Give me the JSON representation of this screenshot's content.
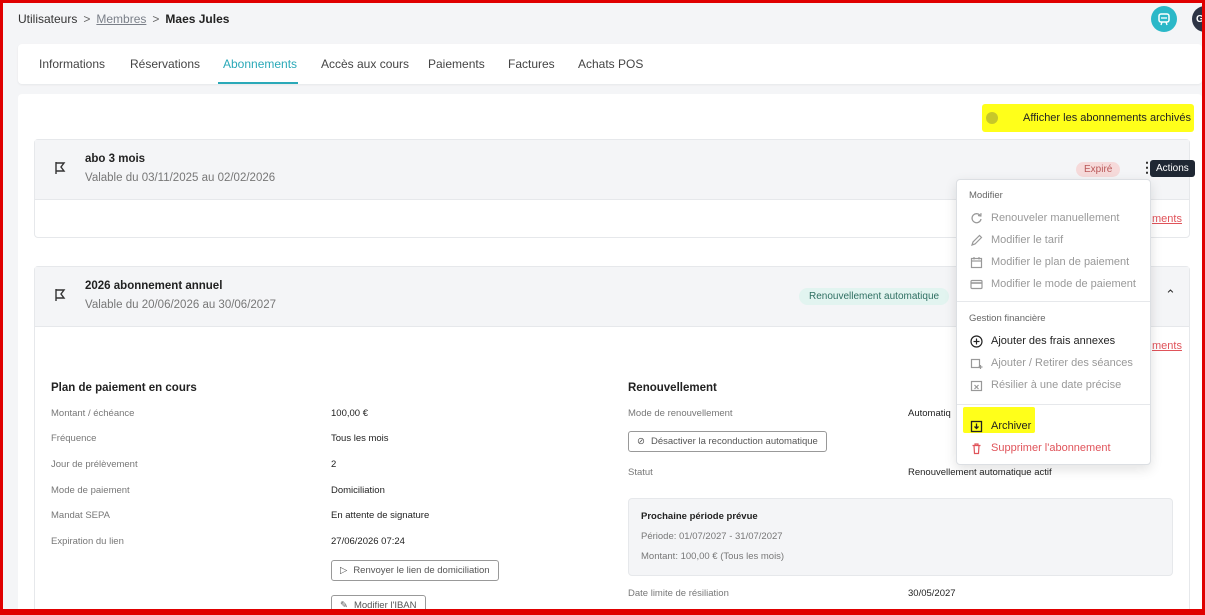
{
  "breadcrumb": {
    "root": "Utilisateurs",
    "sep": ">",
    "members": "Membres",
    "current": "Maes Jules"
  },
  "avatar_initial": "G",
  "tabs": [
    "Informations",
    "Réservations",
    "Abonnements",
    "Accès aux cours",
    "Paiements",
    "Factures",
    "Achats POS"
  ],
  "active_tab": "Abonnements",
  "archived_toggle_label": "Afficher les abonnements archivés",
  "card1": {
    "title": "abo 3 mois",
    "validity": "Valable du 03/11/2025 au 02/02/2026",
    "status": "Expiré",
    "link": "ments"
  },
  "tooltip": "Actions",
  "card2": {
    "title": "2026 abonnement annuel",
    "validity": "Valable du 20/06/2026 au 30/06/2027",
    "status": "Renouvellement automatique",
    "link": "ments",
    "plan": {
      "heading": "Plan de paiement en cours",
      "rows": [
        {
          "label": "Montant / échéance",
          "value": "100,00 €"
        },
        {
          "label": "Fréquence",
          "value": "Tous les mois"
        },
        {
          "label": "Jour de prélèvement",
          "value": "2"
        },
        {
          "label": "Mode de paiement",
          "value": "Domiciliation"
        },
        {
          "label": "Mandat SEPA",
          "value": "En attente de signature"
        },
        {
          "label": "Expiration du lien",
          "value": "27/06/2026 07:24"
        }
      ],
      "resend_button": "Renvoyer le lien de domiciliation",
      "iban_button": "Modifier l'IBAN"
    },
    "renewal": {
      "heading": "Renouvellement",
      "mode_label": "Mode de renouvellement",
      "mode_value": "Automatiq",
      "disable_button": "Désactiver la reconduction automatique",
      "status_label": "Statut",
      "status_value": "Renouvellement automatique actif",
      "next_title": "Prochaine période prévue",
      "next_period": "Période: 01/07/2027 - 31/07/2027",
      "next_amount": "Montant: 100,00 € (Tous les mois)",
      "deadline_label": "Date limite de résiliation",
      "deadline_value": "30/05/2027"
    }
  },
  "menu": {
    "group1": "Modifier",
    "items1": [
      "Renouveler manuellement",
      "Modifier le tarif",
      "Modifier le plan de paiement",
      "Modifier le mode de paiement"
    ],
    "group2": "Gestion financière",
    "items2": [
      "Ajouter des frais annexes",
      "Ajouter / Retirer des séances",
      "Résilier à une date précise"
    ],
    "archive": "Archiver",
    "delete": "Supprimer l'abonnement"
  },
  "colors": {
    "accent": "#2aa9b8",
    "danger": "#e0535a",
    "highlight": "#ffff00",
    "frame": "#e00000"
  }
}
